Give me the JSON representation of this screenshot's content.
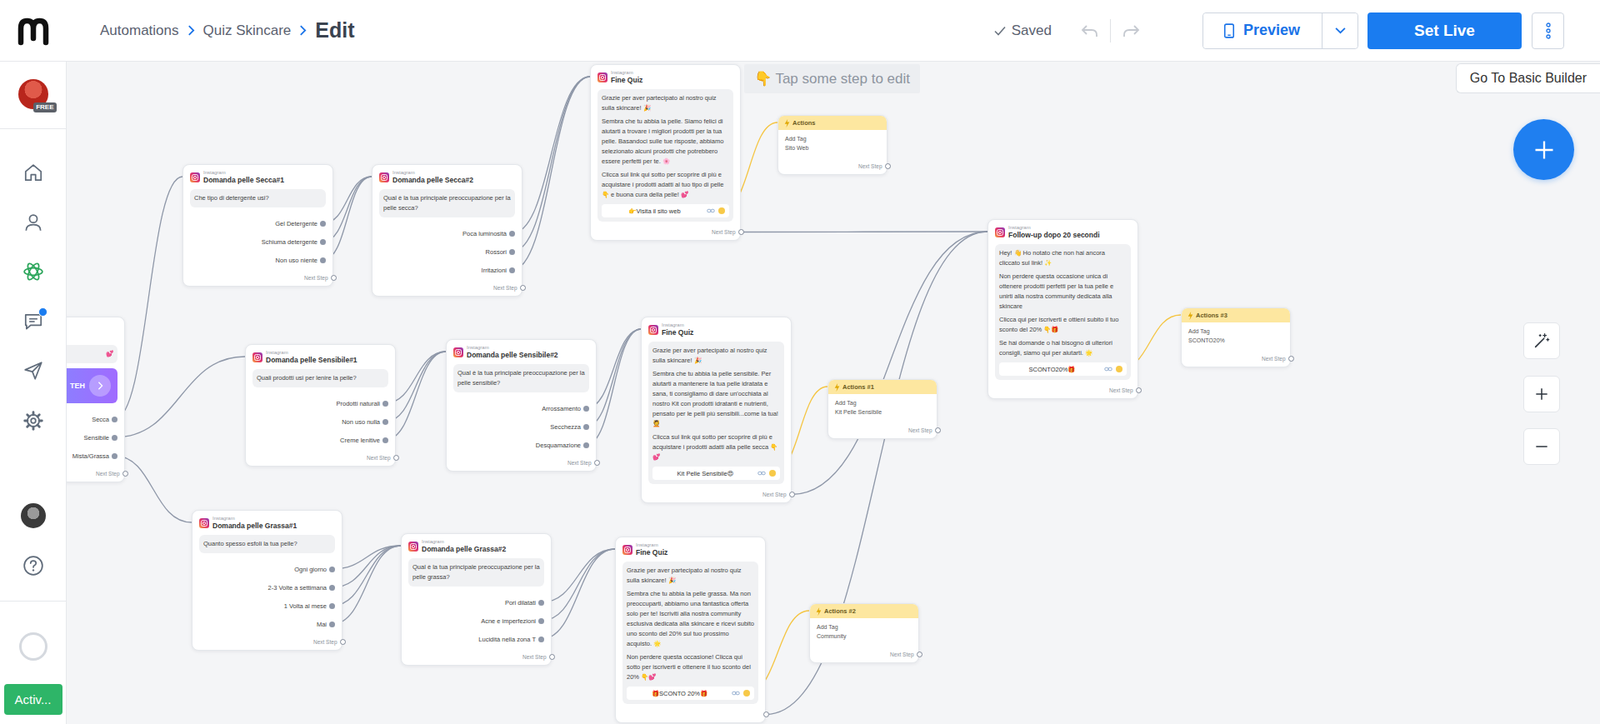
{
  "topbar": {
    "breadcrumb": [
      {
        "label": "Automations"
      },
      {
        "label": "Quiz Skincare"
      }
    ],
    "current": "Edit",
    "status": "Saved",
    "undo": {
      "disabled": true
    },
    "redo": {
      "disabled": true
    },
    "preview": "Preview",
    "set_live": "Set Live"
  },
  "sidebar": {
    "badge": "FREE",
    "items": [
      {
        "selected": false,
        "notification": false
      },
      {
        "selected": false,
        "notification": false
      },
      {
        "selected": true,
        "notification": false
      },
      {
        "selected": false,
        "notification": true
      },
      {
        "selected": false,
        "notification": false
      },
      {
        "selected": false,
        "notification": false
      }
    ],
    "status_button": "Activ..."
  },
  "canvas": {
    "hint": "👇 Tap some step to edit",
    "basic_builder": "Go To Basic Builder"
  },
  "nodes": [
    {
      "kind": "start",
      "message": [
        "💕"
      ],
      "card": "TEH",
      "options": [
        "Secca",
        "Sensibile",
        "Mista/Grassa"
      ],
      "next": "Next Step"
    },
    {
      "kind": "question",
      "channel": "Instagram",
      "title": "Domanda pelle Secca#1",
      "message": [
        "Che tipo di detergente usi?"
      ],
      "options": [
        "Gel Detergente",
        "Schiuma detergente",
        "Non uso niente"
      ],
      "next": "Next Step"
    },
    {
      "kind": "question",
      "channel": "Instagram",
      "title": "Domanda pelle Secca#2",
      "message": [
        "Qual è la tua principale preoccupazione per la pelle secca?"
      ],
      "options": [
        "Poca luminosità",
        "Rossori",
        "Irritazioni"
      ],
      "next": "Next Step"
    },
    {
      "kind": "message",
      "channel": "Instagram",
      "title": "Fine Quiz",
      "message": [
        "Grazie per aver partecipato al nostro quiz sulla skincare! 🎉",
        "Sembra che tu abbia la pelle. Siamo felici di aiutarti a trovare i migliori prodotti per la tua pelle. Basandoci sulle tue risposte, abbiamo selezionato alcuni prodotti che potrebbero essere perfetti per te. 🌸",
        "Clicca sul link qui sotto per scoprire di più e acquistare i prodotti adatti al tuo tipo di pelle👇 e buona cura della pelle! 💕"
      ],
      "button": "👉Visita il sito web",
      "next": "Next Step"
    },
    {
      "kind": "action",
      "title": "Actions",
      "label": "Add Tag",
      "tag": "Sito Web",
      "next": "Next Step"
    },
    {
      "kind": "question",
      "channel": "Instagram",
      "title": "Domanda pelle Sensibile#1",
      "message": [
        "Quali prodotti usi per lenire la pelle?"
      ],
      "options": [
        "Prodotti naturali",
        "Non uso nulla",
        "Creme lenitive"
      ],
      "next": "Next Step"
    },
    {
      "kind": "question",
      "channel": "Instagram",
      "title": "Domanda pelle Sensibile#2",
      "message": [
        "Qual è la tua principale preoccupazione per la pelle sensibile?"
      ],
      "options": [
        "Arrossamento",
        "Secchezza",
        "Desquamazione"
      ],
      "next": "Next Step"
    },
    {
      "kind": "message",
      "channel": "Instagram",
      "title": "Fine Quiz",
      "message": [
        "Grazie per aver partecipato al nostro quiz sulla skincare! 🎉",
        "Sembra che tu abbia la pelle sensibile. Per aiutarti a mantenere la tua pelle idratata e sana, ti consigliamo di dare un'occhiata al nostro Kit con prodotti idratanti e nutrienti, pensato per le pelli più sensibili...come la tua! 💆",
        "Clicca sul link qui sotto per scoprire di più e acquistare i prodotti adatti alla pelle secca 👇💕"
      ],
      "button": "Kit Pelle Sensibile😍",
      "next": "Next Step"
    },
    {
      "kind": "action",
      "title": "Actions #1",
      "label": "Add Tag",
      "tag": "Kit Pelle Sensibile",
      "next": "Next Step"
    },
    {
      "kind": "question",
      "channel": "Instagram",
      "title": "Domanda pelle Grassa#1",
      "message": [
        "Quanto spesso esfoli la tua pelle?"
      ],
      "options": [
        "Ogni giorno",
        "2-3 Volte a settimana",
        "1 Volta al mese",
        "Mai"
      ],
      "next": "Next Step"
    },
    {
      "kind": "question",
      "channel": "Instagram",
      "title": "Domanda pelle Grassa#2",
      "message": [
        "Qual è la tua principale preoccupazione per la pelle grassa?"
      ],
      "options": [
        "Pori dilatati",
        "Acne e imperfezioni",
        "Lucidità nella zona T"
      ],
      "next": "Next Step"
    },
    {
      "kind": "message",
      "channel": "Instagram",
      "title": "Fine Quiz",
      "message": [
        "Grazie per aver partecipato al nostro quiz sulla skincare! 🎉",
        "Sembra che tu abbia la pelle grassa. Ma non preoccuparti, abbiamo una fantastica offerta solo per te! Iscriviti alla nostra community esclusiva dedicata alla skincare e ricevi subito uno sconto del 20% sul tuo prossimo acquisto. 🌟",
        "Non perdere questa occasione! Clicca qui sotto per iscriverti e ottenere il tuo sconto del 20% 👇💕"
      ],
      "button": "🎁SCONTO 20%🎁"
    },
    {
      "kind": "action",
      "title": "Actions #2",
      "label": "Add Tag",
      "tag": "Community",
      "next": "Next Step"
    },
    {
      "kind": "message",
      "channel": "Instagram",
      "title": "Follow-up dopo 20 secondi",
      "message": [
        "Hey! 👋 Ho notato che non hai ancora cliccato sul link! ✨",
        "Non perdere questa occasione unica di ottenere prodotti perfetti per la tua pelle e unirti alla nostra community dedicata alla skincare",
        "Clicca qui per iscriverti e ottieni subito il tuo sconto del 20% 👇🎁",
        "Se hai domande o hai bisogno di ulteriori consigli, siamo qui per aiutarti. 🌟"
      ],
      "button": "SCONTO20%🎁",
      "next": "Next Step"
    },
    {
      "kind": "action",
      "title": "Actions #3",
      "label": "Add Tag",
      "tag": "SCONTO20%",
      "next": "Next Step"
    }
  ]
}
